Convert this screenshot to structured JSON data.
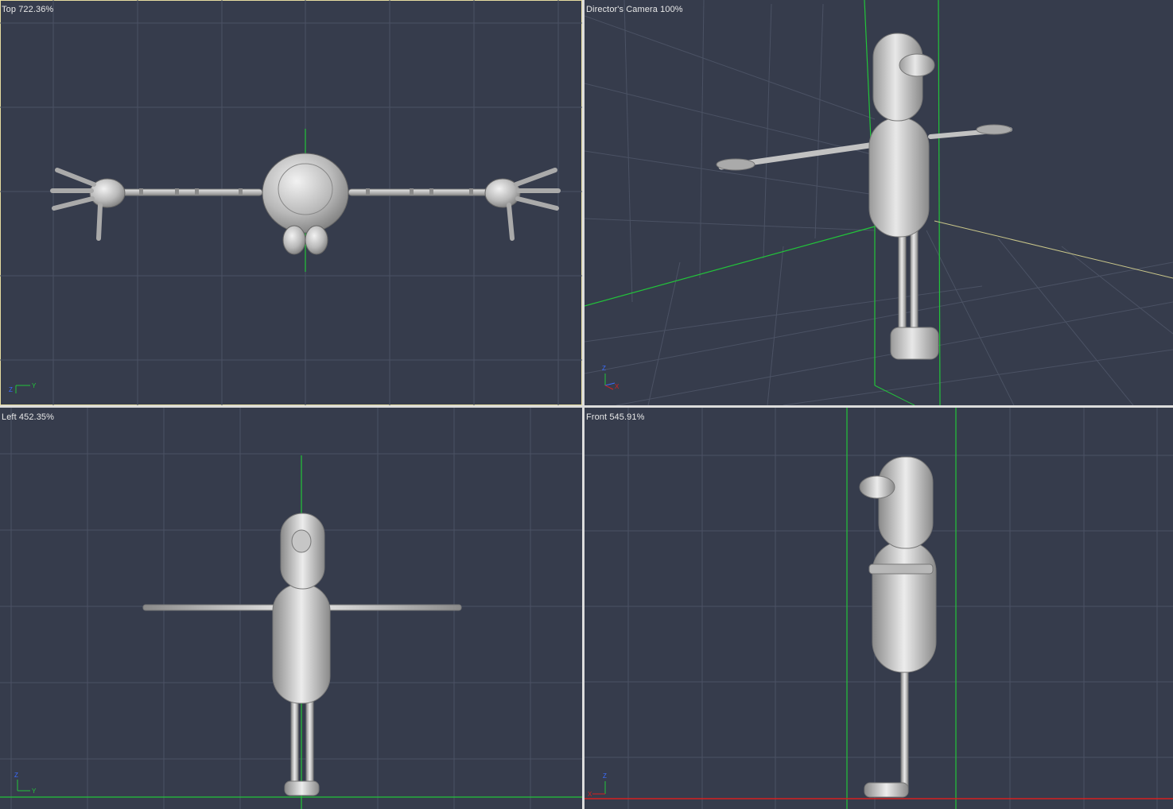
{
  "viewports": {
    "top": {
      "label": "Top 722.36%"
    },
    "camera": {
      "label": "Director's Camera 100%"
    },
    "left": {
      "label": "Left 452.35%"
    },
    "front": {
      "label": "Front 545.91%"
    }
  },
  "active_viewport": "top",
  "axis_labels": {
    "x": "X",
    "y": "Y",
    "z": "Z"
  },
  "colors": {
    "background": "#363c4c",
    "grid": "#4b5264",
    "green_axis": "#22c43a",
    "red_axis": "#d62020",
    "mesh": "#c9c9c9",
    "active_border": "#e6dca0"
  }
}
